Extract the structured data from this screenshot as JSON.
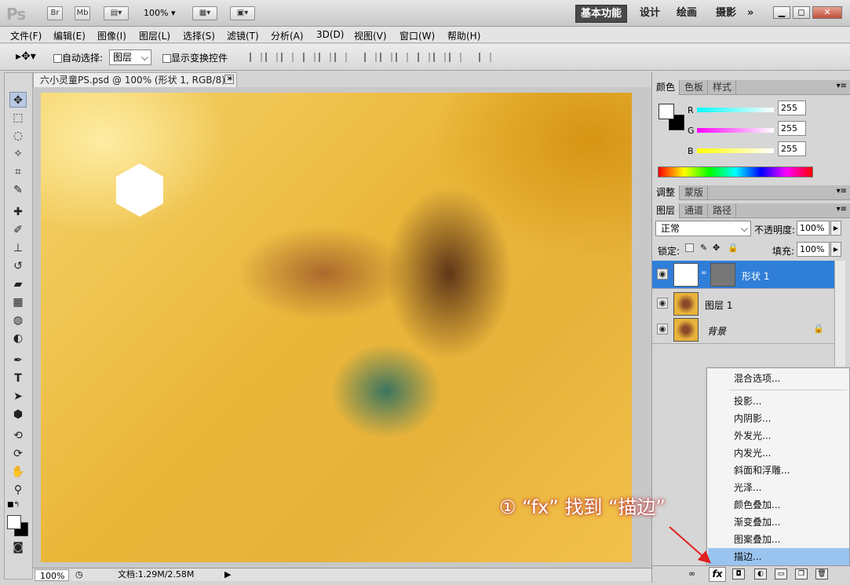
{
  "app": {
    "logo": "Ps",
    "br": "Br",
    "mb": "Mb",
    "zoom": "100%"
  },
  "workspaces": {
    "essentials": "基本功能",
    "design": "设计",
    "painting": "绘画",
    "photography": "摄影",
    "more": "»"
  },
  "menu": [
    "文件(F)",
    "编辑(E)",
    "图像(I)",
    "图层(L)",
    "选择(S)",
    "滤镜(T)",
    "分析(A)",
    "3D(D)",
    "视图(V)",
    "窗口(W)",
    "帮助(H)"
  ],
  "options": {
    "auto_select_label": "自动选择:",
    "auto_select_value": "图层",
    "show_transform_label": "显示变换控件"
  },
  "document": {
    "tab_title": "六小灵童PS.psd @ 100% (形状 1, RGB/8) *",
    "zoom": "100%",
    "doc_info": "文档:1.29M/2.58M"
  },
  "color_panel": {
    "tabs": [
      "颜色",
      "色板",
      "样式"
    ],
    "r_label": "R",
    "g_label": "G",
    "b_label": "B",
    "r": "255",
    "g": "255",
    "b": "255"
  },
  "adjust_panel": {
    "tabs": [
      "调整",
      "蒙版"
    ]
  },
  "layers_panel": {
    "tabs": [
      "图层",
      "通道",
      "路径"
    ],
    "blend_mode": "正常",
    "opacity_label": "不透明度:",
    "opacity": "100%",
    "lock_label": "锁定:",
    "fill_label": "填充:",
    "fill": "100%",
    "layers": [
      {
        "name": "形状 1"
      },
      {
        "name": "图层 1"
      },
      {
        "name": "背景"
      }
    ]
  },
  "context_menu": {
    "items": [
      "混合选项...",
      "投影...",
      "内阴影...",
      "外发光...",
      "内发光...",
      "斜面和浮雕...",
      "光泽...",
      "颜色叠加...",
      "渐变叠加...",
      "图案叠加...",
      "描边..."
    ],
    "highlighted": "描边..."
  },
  "annotation": {
    "text": "① “fx” 找到 “描边”"
  },
  "colors": {
    "accent": "#2f7ed8",
    "highlight": "#99c4f0",
    "annotation_glow": "#c44444"
  }
}
